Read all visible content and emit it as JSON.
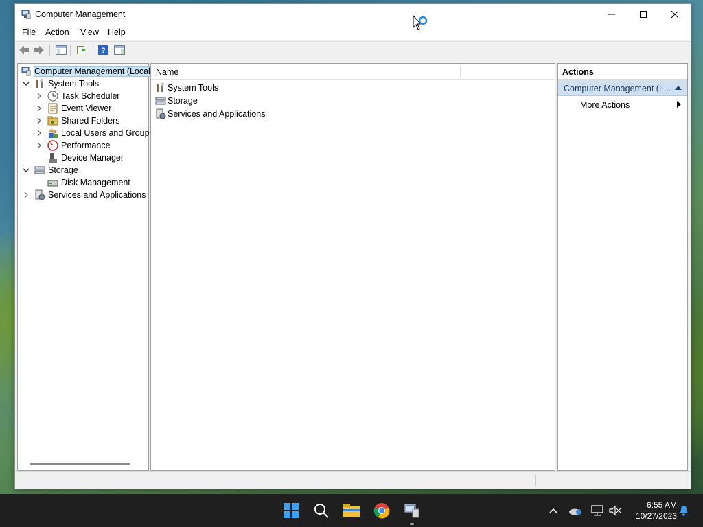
{
  "window": {
    "title": "Computer Management",
    "controls": {
      "minimize": "minimize",
      "maximize": "maximize",
      "close": "close"
    }
  },
  "menu": [
    "File",
    "Action",
    "View",
    "Help"
  ],
  "toolbar": [
    "back-icon",
    "forward-icon",
    "show-hide-console-tree-icon",
    "export-list-icon",
    "help-icon",
    "show-hide-action-pane-icon"
  ],
  "tree": {
    "root": "Computer Management (Local",
    "items": [
      {
        "label": "System Tools",
        "expanded": true
      },
      {
        "label": "Task Scheduler"
      },
      {
        "label": "Event Viewer"
      },
      {
        "label": "Shared Folders"
      },
      {
        "label": "Local Users and Groups"
      },
      {
        "label": "Performance"
      },
      {
        "label": "Device Manager"
      },
      {
        "label": "Storage",
        "expanded": true
      },
      {
        "label": "Disk Management"
      },
      {
        "label": "Services and Applications"
      }
    ]
  },
  "list": {
    "column": "Name",
    "rows": [
      "System Tools",
      "Storage",
      "Services and Applications"
    ]
  },
  "actions": {
    "header": "Actions",
    "section": "Computer Management (L...",
    "more": "More Actions"
  },
  "taskbar": {
    "apps": [
      "start-icon",
      "search-icon",
      "file-explorer-icon",
      "chrome-icon",
      "computer-management-icon"
    ],
    "tray": [
      "chevron-up-icon",
      "onedrive-icon",
      "network-icon",
      "volume-muted-icon",
      "notification-icon"
    ],
    "time": "6:55 AM",
    "date": "10/27/2023"
  },
  "colors": {
    "accent": "#0078d4",
    "selection": "#cce4f7",
    "actions_section": "#cfe0f0",
    "taskbar": "#1f1f1f"
  }
}
